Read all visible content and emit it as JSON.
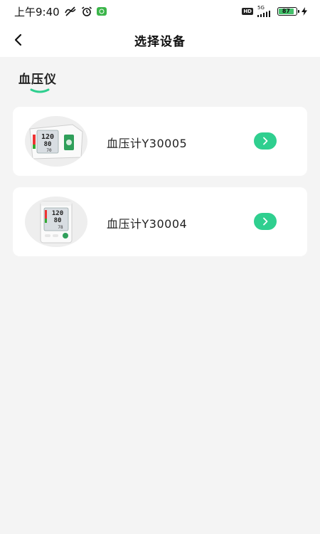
{
  "status_bar": {
    "time": "上午9:40",
    "hd_badge": "HD",
    "network": "5G",
    "battery_level": "87"
  },
  "header": {
    "title": "选择设备",
    "back_icon": "chevron-left-icon"
  },
  "section": {
    "title": "血压仪",
    "accent_color": "#2fcf8f"
  },
  "devices": [
    {
      "name": "血压计Y30005",
      "action_icon": "chevron-right-icon"
    },
    {
      "name": "血压计Y30004",
      "action_icon": "chevron-right-icon"
    }
  ],
  "colors": {
    "accent": "#2fcf8f",
    "background": "#f4f4f4",
    "card": "#ffffff"
  }
}
